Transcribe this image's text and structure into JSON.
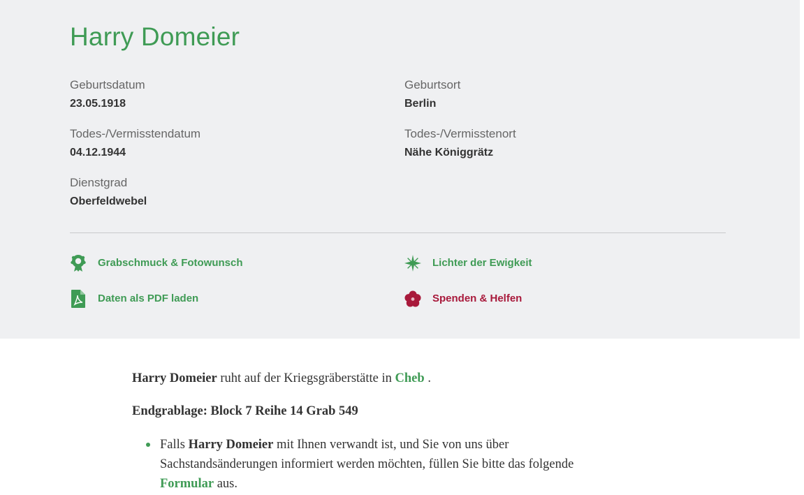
{
  "person": {
    "name": "Harry Domeier"
  },
  "fields": {
    "birth_date_label": "Geburtsdatum",
    "birth_date": "23.05.1918",
    "birth_place_label": "Geburtsort",
    "birth_place": "Berlin",
    "death_date_label": "Todes-/Vermisstendatum",
    "death_date": "04.12.1944",
    "death_place_label": "Todes-/Vermisstenort",
    "death_place": "Nähe Königgrätz",
    "rank_label": "Dienstgrad",
    "rank": "Oberfeldwebel"
  },
  "actions": {
    "wreath": {
      "label": "Grabschmuck & Fotowunsch",
      "icon": "wreath-icon"
    },
    "candle": {
      "label": "Lichter der Ewigkeit",
      "icon": "star-light-icon"
    },
    "pdf": {
      "label": "Daten als PDF laden",
      "icon": "pdf-file-icon"
    },
    "donate": {
      "label": "Spenden & Helfen",
      "icon": "flower-icon"
    }
  },
  "content": {
    "rest_name": "Harry Domeier",
    "rest_text": " ruht auf der Kriegsgräberstätte in ",
    "rest_place": "Cheb",
    "rest_end": " .",
    "grave": "Endgrablage: Block 7 Reihe 14 Grab 549",
    "note_pre": "Falls ",
    "note_name": "Harry Domeier",
    "note_mid": " mit Ihnen verwandt ist, und Sie von uns über Sachstandsänderungen informiert werden möchten, füllen Sie bitte das folgende ",
    "note_link": "Formular",
    "note_end": " aus."
  },
  "colors": {
    "accent_green": "#3f9b55",
    "accent_red": "#a8193b",
    "panel_bg": "#eff0f2"
  }
}
